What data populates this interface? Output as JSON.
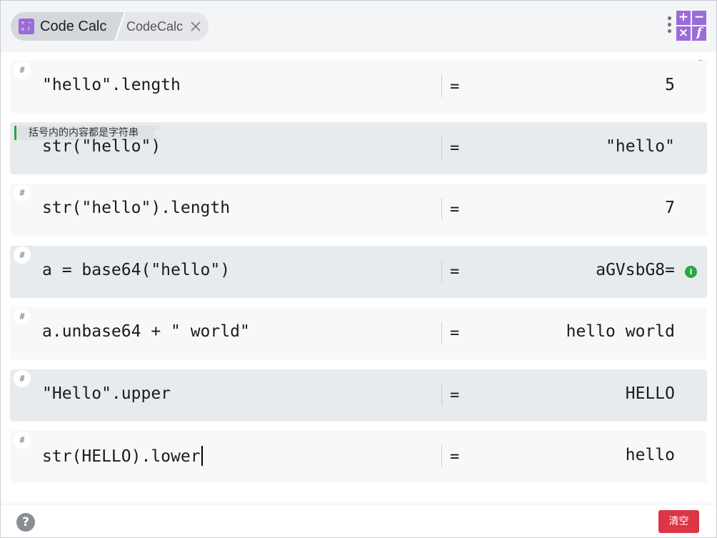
{
  "header": {
    "app_title": "Code Calc",
    "second_tab": "CodeCalc",
    "brand_logo": {
      "cells": [
        "+",
        "−",
        "×",
        "f"
      ],
      "color": "#9b6cd8"
    },
    "icons": [
      "calculator-icon",
      "close-icon",
      "more-vertical-icon",
      "history-icon"
    ]
  },
  "rows": [
    {
      "expr": "\"hello\".length",
      "eq": "=",
      "result": "5",
      "marker": "#",
      "shade": "light"
    },
    {
      "comment": "括号内的内容都是字符串",
      "expr": "str(\"hello\")",
      "eq": "=",
      "result": "\"hello\"",
      "shade": "dark"
    },
    {
      "expr": "str(\"hello\").length",
      "eq": "=",
      "result": "7",
      "marker": "#",
      "shade": "light"
    },
    {
      "expr": "a = base64(\"hello\")",
      "eq": "=",
      "result": "aGVsbG8=",
      "marker": "#",
      "shade": "dark",
      "info_icon": "i"
    },
    {
      "expr": "a.unbase64 + \" world\"",
      "eq": "=",
      "result": "hello world",
      "marker": "#",
      "shade": "light"
    },
    {
      "expr": "\"Hello\".upper",
      "eq": "=",
      "result": "HELLO",
      "marker": "#",
      "shade": "dark"
    },
    {
      "expr": "str(HELLO).lower",
      "eq": "=",
      "result": "hello",
      "marker": "#",
      "shade": "light",
      "focused": true
    }
  ],
  "footer": {
    "help_label": "?",
    "clear_label": "清空"
  },
  "colors": {
    "accent": "#9b6cd8",
    "danger": "#dc3545",
    "success": "#27a745"
  }
}
